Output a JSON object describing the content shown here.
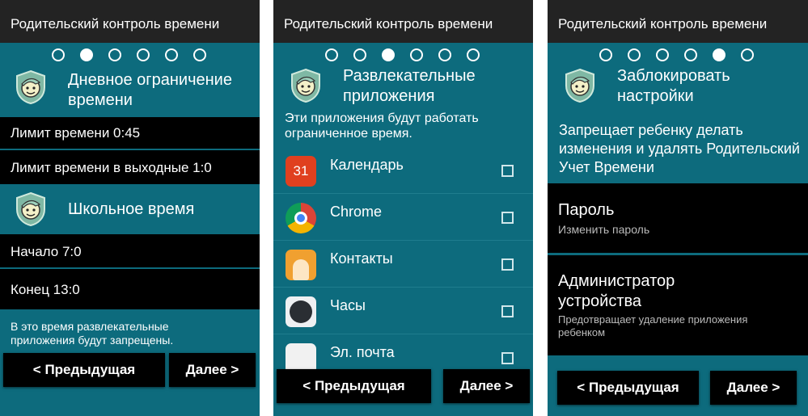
{
  "app_title": "Родительский контроль времени",
  "colors": {
    "background": "#0d6b7d",
    "header": "#232323",
    "row": "#000000"
  },
  "icons": {
    "shield": "child-shield-icon"
  },
  "buttons": {
    "prev": "< Предыдущая",
    "next": "Далее >"
  },
  "pages": [
    {
      "active_dot": 2,
      "section1_title": "Дневное ограничение времени",
      "rows1": [
        "Лимит времени 0:45",
        "Лимит времени в выходные 1:0"
      ],
      "section2_title": "Школьное время",
      "rows2": [
        "Начало 7:0",
        "Конец 13:0"
      ],
      "note": "В это время развлекательные приложения будут запрещены."
    },
    {
      "active_dot": 3,
      "title": "Развлекательные приложения",
      "description": "Эти приложения будут работать ограниченное время.",
      "apps": [
        {
          "name": "Календарь",
          "icon": "calendar-icon",
          "icon_text": "31",
          "checked": false
        },
        {
          "name": "Chrome",
          "icon": "chrome-icon",
          "checked": false
        },
        {
          "name": "Контакты",
          "icon": "contacts-icon",
          "checked": false
        },
        {
          "name": "Часы",
          "icon": "clock-icon",
          "checked": false
        },
        {
          "name": "Эл. почта",
          "icon": "email-icon",
          "checked": false
        }
      ]
    },
    {
      "active_dot": 5,
      "title": "Заблокировать настройки",
      "description": "Запрещает ребенку делать изменения и удалять Родительский Учет Времени",
      "items": [
        {
          "title": "Пароль",
          "subtitle": "Изменить пароль"
        },
        {
          "title": "Администратор устройства",
          "subtitle": "Предотвращает удаление приложения ребенком"
        }
      ]
    }
  ]
}
